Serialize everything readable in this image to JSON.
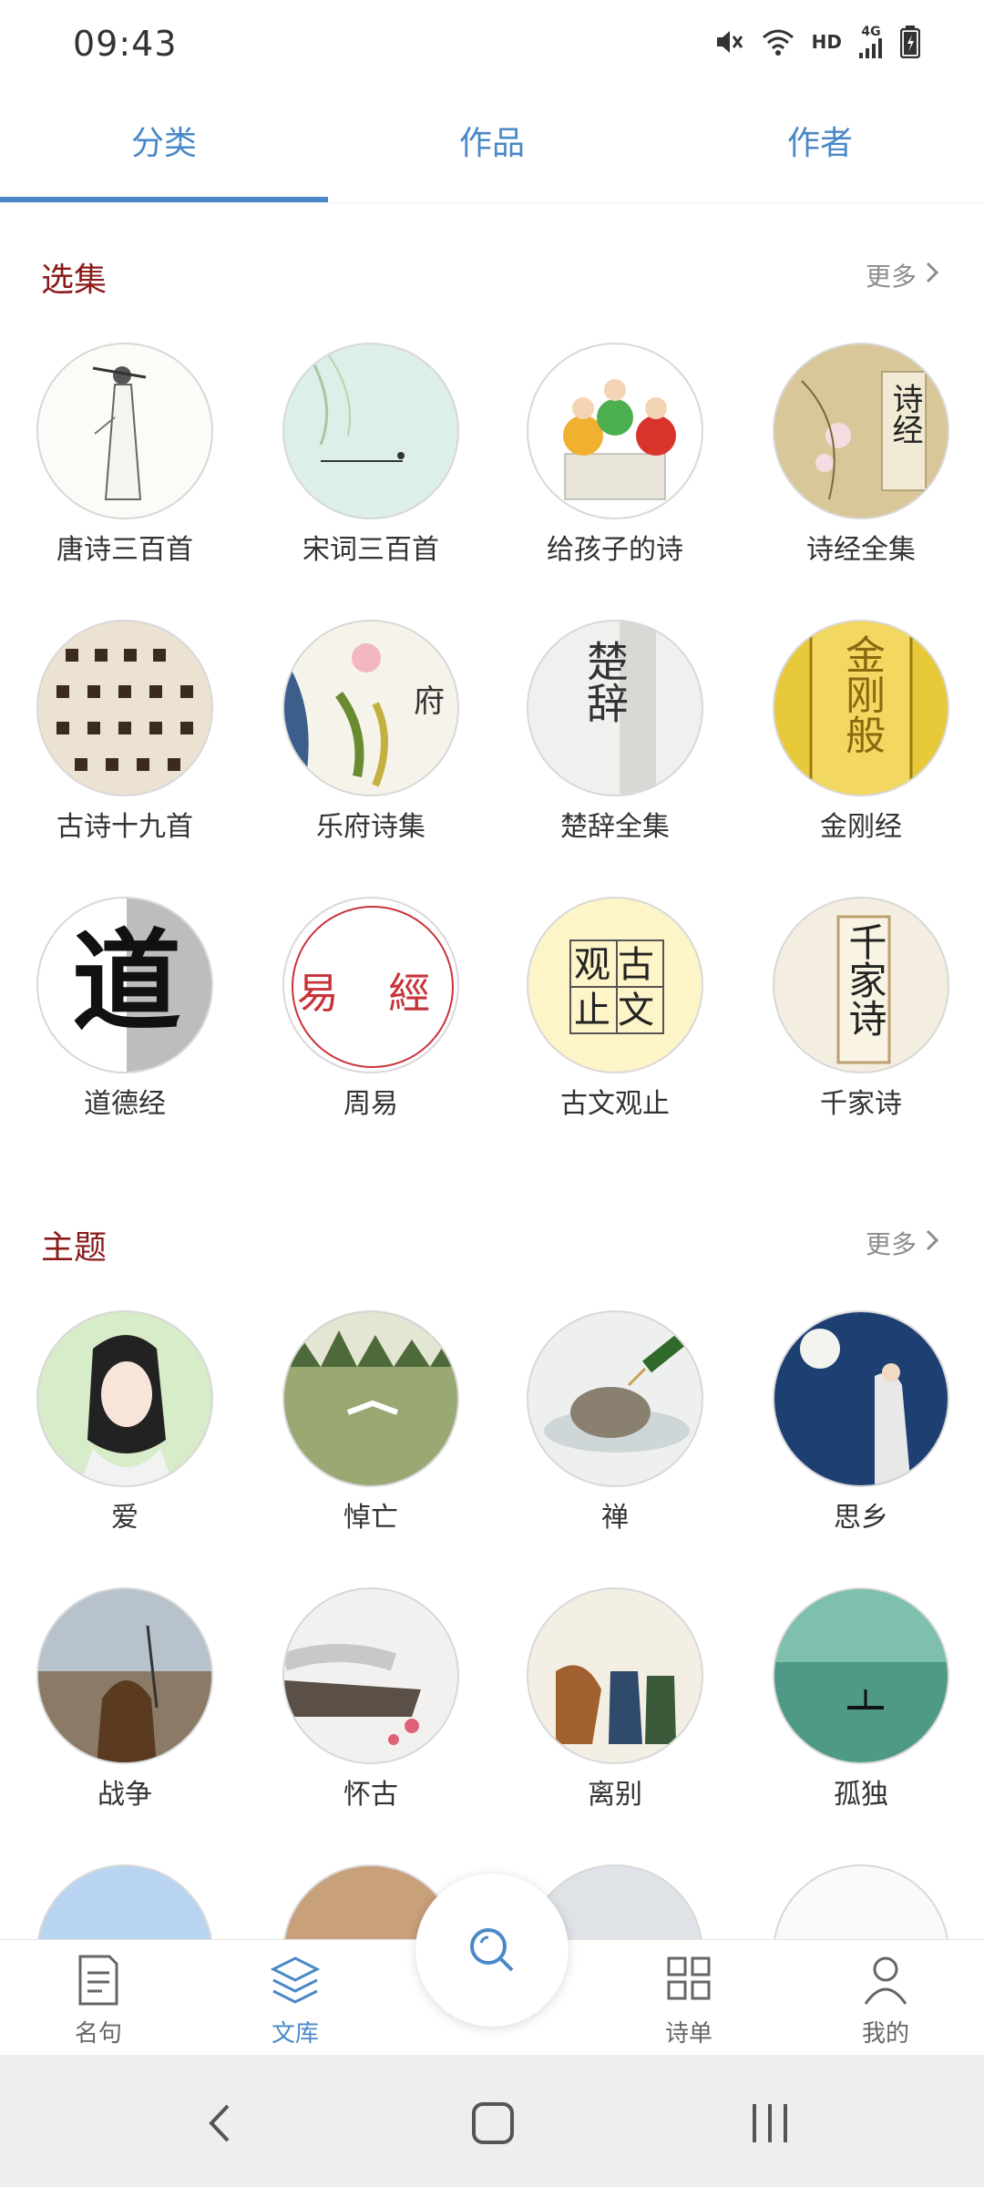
{
  "status_bar": {
    "time": "09:43",
    "network_label": "HD",
    "signal_label": "4G"
  },
  "tabs": [
    {
      "label": "分类",
      "active": true
    },
    {
      "label": "作品",
      "active": false
    },
    {
      "label": "作者",
      "active": false
    }
  ],
  "sections": {
    "anthology": {
      "title": "选集",
      "more_label": "更多",
      "items": [
        {
          "label": "唐诗三百首",
          "glyph": ""
        },
        {
          "label": "宋词三百首",
          "glyph": ""
        },
        {
          "label": "给孩子的诗",
          "glyph": ""
        },
        {
          "label": "诗经全集",
          "glyph": "诗经"
        },
        {
          "label": "古诗十九首",
          "glyph": ""
        },
        {
          "label": "乐府诗集",
          "glyph": "府"
        },
        {
          "label": "楚辞全集",
          "glyph": "楚辞"
        },
        {
          "label": "金刚经",
          "glyph": "金刚般"
        },
        {
          "label": "道德经",
          "glyph": "道"
        },
        {
          "label": "周易",
          "glyph": "易 經"
        },
        {
          "label": "古文观止",
          "glyph": "观古止文"
        },
        {
          "label": "千家诗",
          "glyph": "千家诗"
        }
      ]
    },
    "themes": {
      "title": "主题",
      "more_label": "更多",
      "items": [
        {
          "label": "爱"
        },
        {
          "label": "悼亡"
        },
        {
          "label": "禅"
        },
        {
          "label": "思乡"
        },
        {
          "label": "战争"
        },
        {
          "label": "怀古"
        },
        {
          "label": "离别"
        },
        {
          "label": "孤独"
        }
      ]
    }
  },
  "bottom_nav": [
    {
      "label": "名句",
      "icon": "document-icon",
      "active": false
    },
    {
      "label": "文库",
      "icon": "layers-icon",
      "active": true
    },
    {
      "label": "诗单",
      "icon": "grid-icon",
      "active": false
    },
    {
      "label": "我的",
      "icon": "person-icon",
      "active": false
    }
  ],
  "colors": {
    "accent": "#4a88c7",
    "section_title": "#8b1a1a",
    "text": "#333333",
    "muted": "#8c8c8c"
  }
}
